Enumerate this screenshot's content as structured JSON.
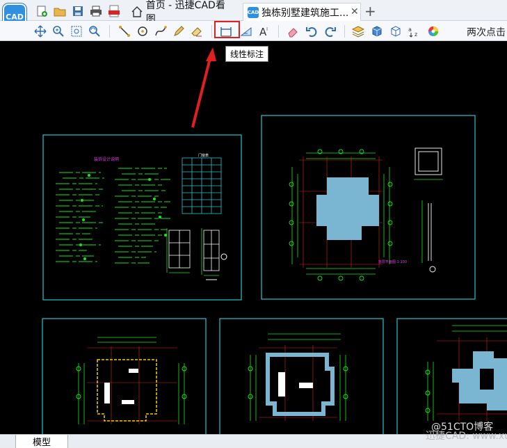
{
  "app": {
    "logo_text": "CAD"
  },
  "tabs": {
    "home": {
      "label": "首页 - 迅捷CAD看图"
    },
    "file": {
      "label": "独栋别墅建筑施工...",
      "icon_text": "CAD"
    }
  },
  "toolbar": {
    "hint": "两次点击",
    "tooltip": "线性标注"
  },
  "layout_tabs": {
    "model": "模型"
  },
  "watermark": "迅捷CAD: www.xu",
  "watermark2": "@51CTO博客",
  "drawing": {
    "sheet1": {
      "title": "装饰设计说明",
      "table_title": "门窗表"
    },
    "sheet2": {
      "label": "首层平面图 1:100"
    }
  }
}
